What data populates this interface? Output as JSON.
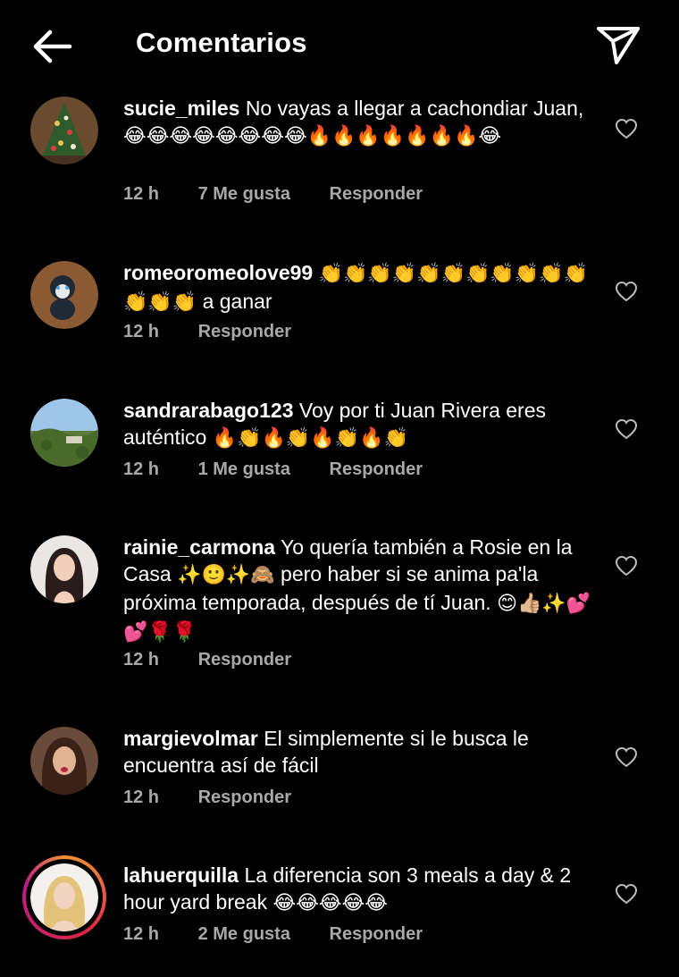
{
  "header": {
    "title": "Comentarios",
    "back_icon": "arrow-left-icon",
    "send_icon": "paper-plane-icon"
  },
  "comments": [
    {
      "username": "sucie_miles",
      "text": "No vayas a llegar a cachondiar Juan,",
      "emojis": "😂😂😂😂😂😂😂😂🔥🔥🔥🔥🔥🔥🔥😂",
      "emojis_after_text": true,
      "time": "12 h",
      "likes": "7 Me gusta",
      "reply": "Responder",
      "avatar": "christmas-tree-photo"
    },
    {
      "username": "romeoromeolove99",
      "text": "a ganar",
      "emojis": "👏👏👏👏👏👏👏👏👏👏👏👏👏👏",
      "emojis_after_text": false,
      "time": "12 h",
      "likes": "",
      "reply": "Responder",
      "avatar": "plush-toy-photo"
    },
    {
      "username": "sandrarabago123",
      "text": "Voy por ti Juan Rivera eres auténtico",
      "emojis": "🔥👏🔥👏🔥👏🔥👏",
      "emojis_after_text": true,
      "time": "12 h",
      "likes": "1 Me gusta",
      "reply": "Responder",
      "avatar": "landscape-photo"
    },
    {
      "username": "rainie_carmona",
      "text_parts": [
        "Yo quería también a Rosie en la Casa",
        " pero haber si se anima pa'la próxima temporada, después de tí Juan."
      ],
      "emoji_mid": "✨🙂✨🙈",
      "emojis": "😊👍🏼✨💕💕🌹🌹",
      "time": "12 h",
      "likes": "",
      "reply": "Responder",
      "avatar": "woman-portrait-photo"
    },
    {
      "username": "margievolmar",
      "text": "El simplemente si le busca le encuentra así de fácil",
      "emojis": "",
      "emojis_after_text": true,
      "time": "12 h",
      "likes": "",
      "reply": "Responder",
      "avatar": "woman-selfie-photo"
    },
    {
      "username": "lahuerquilla",
      "text": "La diferencia son 3 meals a day & 2 hour yard break",
      "emojis": "😂😂😂😂😂",
      "emojis_after_text": true,
      "time": "12 h",
      "likes": "2 Me gusta",
      "reply": "Responder",
      "avatar": "blonde-woman-photo",
      "has_story_ring": true
    }
  ],
  "colors": {
    "background": "#000000",
    "text": "#ffffff",
    "meta": "#a8a8a8"
  }
}
